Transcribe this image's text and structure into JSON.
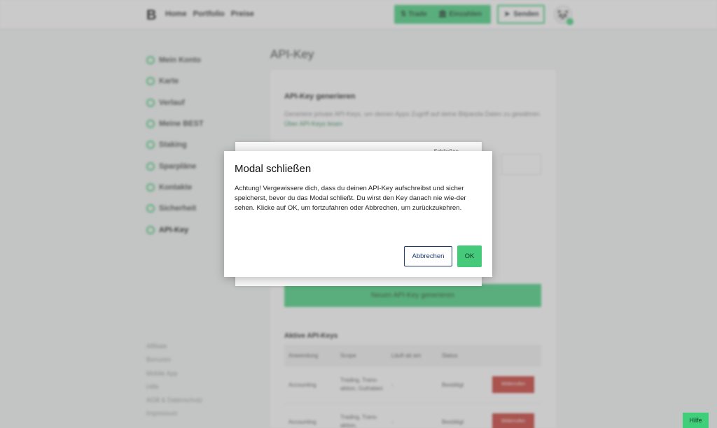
{
  "header": {
    "logo": "B",
    "nav": [
      "Home",
      "Portfolio",
      "Preise"
    ],
    "trade_label": "Trade",
    "deposit_label": "Einzahlen",
    "send_label": "Senden"
  },
  "sidebar": {
    "items": [
      {
        "label": "Mein Konto",
        "icon": "user-icon"
      },
      {
        "label": "Karte",
        "icon": "card-icon"
      },
      {
        "label": "Verlauf",
        "icon": "history-icon"
      },
      {
        "label": "Meine BEST",
        "icon": "best-icon"
      },
      {
        "label": "Staking",
        "icon": "staking-icon"
      },
      {
        "label": "Sparpläne",
        "icon": "savings-icon"
      },
      {
        "label": "Kontakte",
        "icon": "contacts-icon"
      },
      {
        "label": "Sicherheit",
        "icon": "shield-icon"
      },
      {
        "label": "API-Key",
        "icon": "key-icon"
      }
    ],
    "footer": [
      "Affiliate",
      "Bonuses",
      "Mobile App",
      "Hilfe",
      "AGB & Datenschutz",
      "Impressum"
    ]
  },
  "page": {
    "title": "API-Key",
    "card_title": "API-Key generieren",
    "description": "Generiere private API-Keys, um deinen Apps Zugriff auf deine Bitpanda Daten zu gewähren.",
    "description_link": "Über API-Keys lesen",
    "generate_button": "Neuen API-Key generieren",
    "active_keys_title": "Aktive API-Keys",
    "table_headers": [
      "Anwendung",
      "Scope",
      "Läuft ab am",
      "Status"
    ],
    "rows": [
      {
        "app": "Accounting",
        "scope": "Trading, Trans-aktion, Guthaben",
        "expires": "-",
        "status": "Bestätigt",
        "action": "Widerrufen"
      },
      {
        "app": "Accounting",
        "scope": "Trading, Trans-aktion,",
        "expires": "-",
        "status": "Bestätigt",
        "action": "Widerrufen"
      }
    ]
  },
  "under_dialog": {
    "text": "Schließen"
  },
  "modal": {
    "title": "Modal schließen",
    "body": "Achtung! Vergewissere dich, dass du deinen API-Key aufschreibst und sicher speicherst, bevor du das Modal schließt. Du wirst den Key danach nie wie-der sehen. Klicke auf OK, um fortzufahren oder Abbrechen, um zurückzukehren.",
    "cancel_label": "Abbrechen",
    "ok_label": "OK"
  },
  "help_label": "Hilfe",
  "colors": {
    "accent": "#3fcf7a",
    "danger": "#c8332b",
    "navy": "#1d3c6e"
  }
}
